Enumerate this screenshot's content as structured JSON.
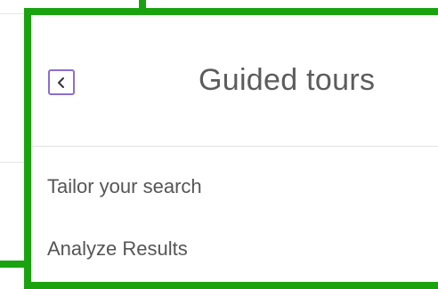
{
  "panel": {
    "title": "Guided tours",
    "back_icon": "chevron-left-icon",
    "items": [
      {
        "label": "Tailor your search"
      },
      {
        "label": "Analyze Results"
      }
    ]
  },
  "colors": {
    "highlight": "#1aa30f",
    "back_button_border": "#8a6fd0",
    "title_text": "#5c5c5c",
    "item_text": "#555555",
    "divider": "#e1e1e1"
  }
}
